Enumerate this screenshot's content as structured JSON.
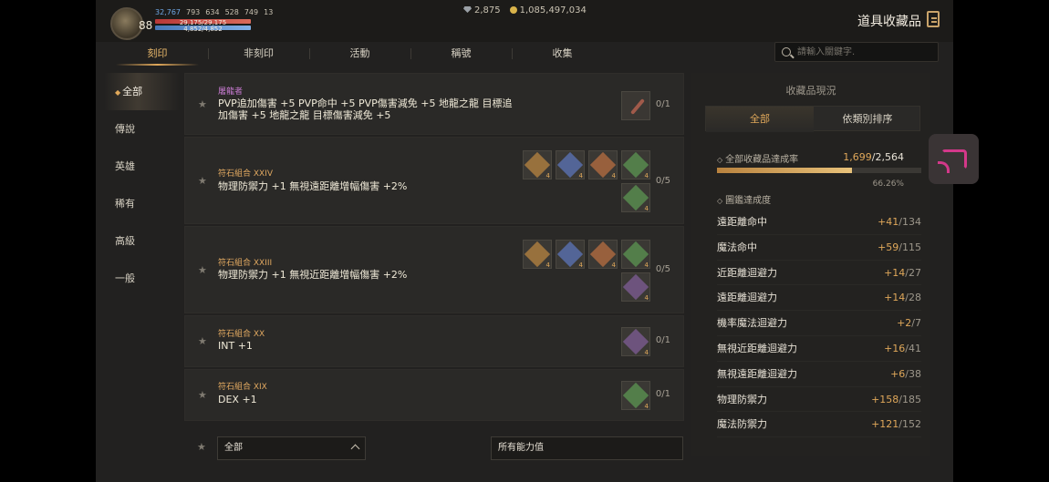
{
  "header": {
    "level": "88",
    "stats": [
      "32,767",
      "793",
      "634",
      "528",
      "749",
      "13"
    ],
    "hp": "29,175/29,175",
    "mp": "4,852/4,852",
    "diamonds": "2,875",
    "gold": "1,085,497,034",
    "title": "道具收藏品"
  },
  "tabs": [
    "刻印",
    "非刻印",
    "活動",
    "稱號",
    "收集"
  ],
  "search": {
    "placeholder": "請輸入關鍵字."
  },
  "sidebar": [
    "全部",
    "傳說",
    "英雄",
    "稀有",
    "高級",
    "一般"
  ],
  "items": [
    {
      "category": "屠龍者",
      "desc": "PVP追加傷害 +5 PVP命中 +5 PVP傷害減免 +5 地龍之龍 目標追加傷害 +5 地龍之龍 目標傷害減免 +5",
      "count": "0/1"
    },
    {
      "category": "符石組合 XXIV",
      "desc": "物理防禦力 +1 無視遠距離增幅傷害 +2%",
      "count": "0/5"
    },
    {
      "category": "符石組合 XXIII",
      "desc": "物理防禦力 +1 無視近距離增幅傷害 +2%",
      "count": "0/5"
    },
    {
      "category": "符石組合 XX",
      "desc": "INT +1",
      "count": "0/1"
    },
    {
      "category": "符石組合 XIX",
      "desc": "DEX +1",
      "count": "0/1"
    }
  ],
  "filters": {
    "grade": "全部",
    "ability": "所有能力值"
  },
  "panel": {
    "title": "收藏品現況",
    "tab_all": "全部",
    "tab_sort": "依類別排序",
    "overall_label": "全部收藏品達成率",
    "overall_current": "1,699",
    "overall_total": "/2,564",
    "overall_pct": "66.26%",
    "overall_fraction": 0.6626,
    "book_label": "圖鑑達成度",
    "rows": [
      {
        "label": "遠距離命中",
        "plus": "+41",
        "total": "/134"
      },
      {
        "label": "魔法命中",
        "plus": "+59",
        "total": "/115"
      },
      {
        "label": "近距離迴避力",
        "plus": "+14",
        "total": "/27"
      },
      {
        "label": "遠距離迴避力",
        "plus": "+14",
        "total": "/28"
      },
      {
        "label": "機率魔法迴避力",
        "plus": "+2",
        "total": "/7"
      },
      {
        "label": "無視近距離迴避力",
        "plus": "+16",
        "total": "/41"
      },
      {
        "label": "無視遠距離迴避力",
        "plus": "+6",
        "total": "/38"
      },
      {
        "label": "物理防禦力",
        "plus": "+158",
        "total": "/185"
      },
      {
        "label": "魔法防禦力",
        "plus": "+121",
        "total": "/152"
      }
    ]
  },
  "colors": {
    "accent": "#e0a85a",
    "cast": "#d4388a"
  }
}
